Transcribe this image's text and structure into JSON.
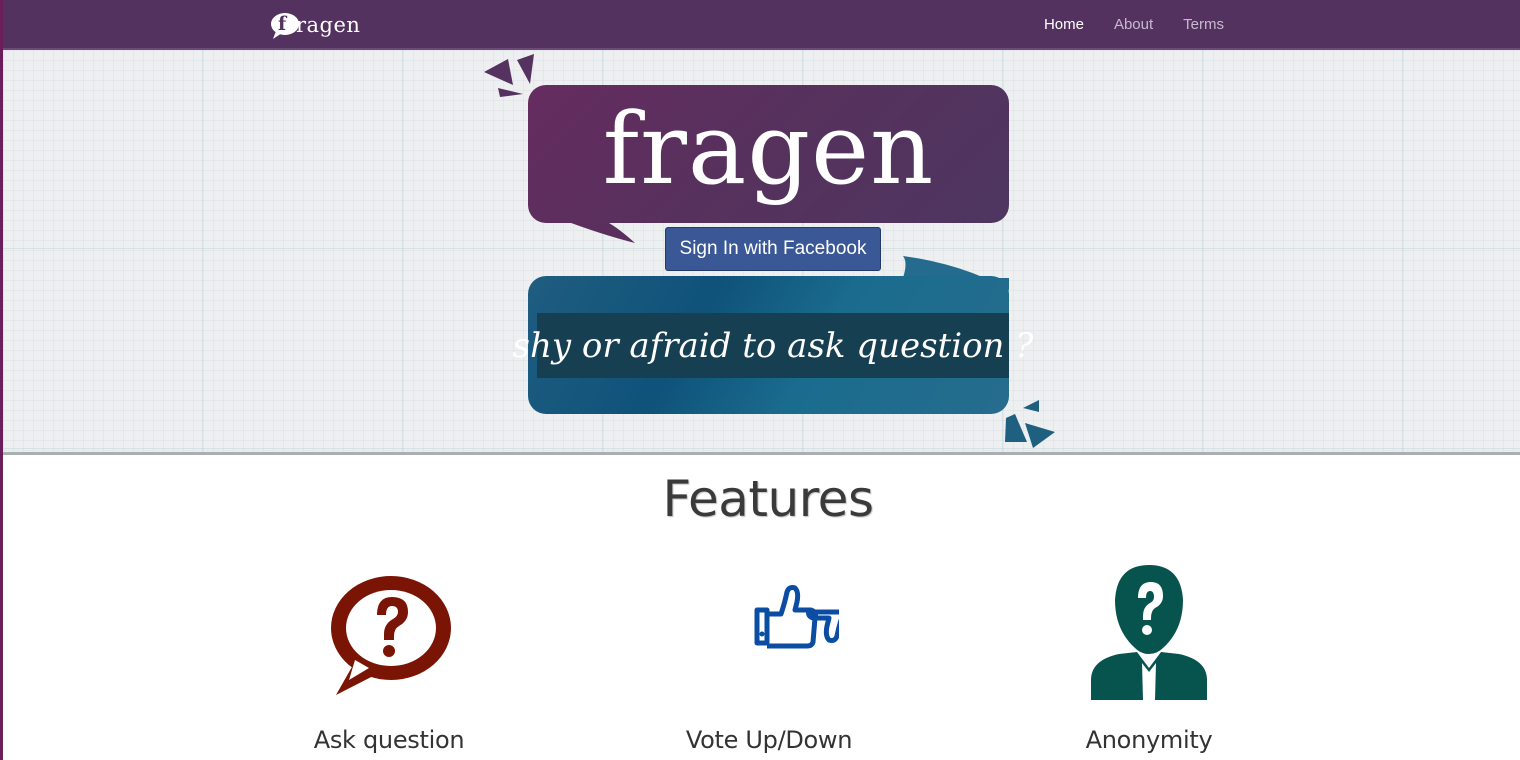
{
  "navbar": {
    "brand_initial": "f",
    "brand_rest": "ragen",
    "links": [
      {
        "label": "Home",
        "active": true
      },
      {
        "label": "About",
        "active": false
      },
      {
        "label": "Terms",
        "active": false
      }
    ]
  },
  "hero": {
    "logo_text": "fragen",
    "signin_label": "Sign In with Facebook",
    "tagline": "shy or afraid to ask question ?"
  },
  "features": {
    "title": "Features",
    "items": [
      {
        "label": "Ask question",
        "icon": "question-speech-bubble-icon",
        "color": "#7a1404"
      },
      {
        "label": "Vote Up/Down",
        "icon": "thumbs-up-down-icon",
        "color": "#0b4da2"
      },
      {
        "label": "Anonymity",
        "icon": "anonymous-person-icon",
        "color": "#07544f"
      }
    ]
  },
  "colors": {
    "navbar": "#54325f",
    "purple_bubble": "#5a2f5e",
    "blue_bubble": "#14567d",
    "facebook_button": "#3a5896"
  }
}
